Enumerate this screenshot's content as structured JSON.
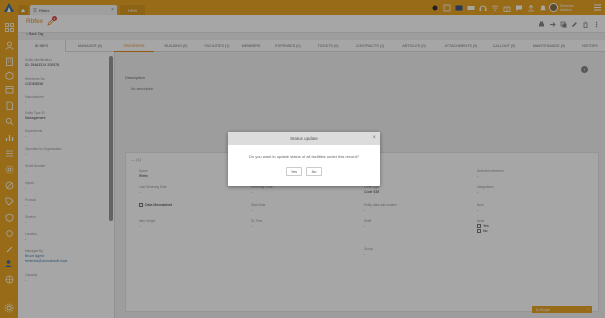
{
  "browser": {
    "active_tab": "Rbfex",
    "new_tab": "NEW",
    "close_glyph": "×"
  },
  "user": {
    "name": "Rkhender",
    "role": "Admin/s"
  },
  "page": {
    "title": "Rbfex",
    "badge": "3",
    "back_link": "< Back Tag"
  },
  "tabs": [
    {
      "label": "ID INFO"
    },
    {
      "label": "MANAGER (0)"
    },
    {
      "label": "PROGRESS"
    },
    {
      "label": "BUILDING (0)"
    },
    {
      "label": "FACILITIES (1)"
    },
    {
      "label": "MEMBERS"
    },
    {
      "label": "EXPENSES (0)"
    },
    {
      "label": "TICKETS (0)"
    },
    {
      "label": "CONTRACTS (1)"
    },
    {
      "label": "ARTICLES (0)"
    },
    {
      "label": "ATTACHMENTS (0)"
    },
    {
      "label": "CALLOUT (0)"
    },
    {
      "label": "MAINTENANCE (0)"
    },
    {
      "label": "HISTORY"
    }
  ],
  "info": {
    "fields": [
      {
        "label": "Entity Identification",
        "value": "ID: 2546331X 200578"
      },
      {
        "label": "Reference No",
        "value": "CODE8538"
      },
      {
        "label": "Manufacturer",
        "value": "-"
      },
      {
        "label": "Entity Type ID",
        "value": "Management"
      },
      {
        "label": "Dependents",
        "value": "-"
      },
      {
        "label": "Operated for Organisation",
        "value": "-"
      },
      {
        "label": "Serial Number",
        "value": "-"
      },
      {
        "label": "Import",
        "value": "-"
      },
      {
        "label": "Product",
        "value": "-"
      },
      {
        "label": "Service",
        "value": "-"
      },
      {
        "label": "Location",
        "value": "-"
      },
      {
        "label": "Managed By",
        "value": "Bruce Agent"
      },
      {
        "label": "",
        "value": "frederick@domainsoft.local"
      },
      {
        "label": "Capacity",
        "value": "-"
      }
    ]
  },
  "main": {
    "description_label": "Description",
    "description_value": "No description",
    "info_glyph": "i",
    "section_title": "— (1)",
    "fields": [
      {
        "label": "Name",
        "value": "Rbfex"
      },
      {
        "label": "Last Servicing Date",
        "value": "-"
      },
      {
        "label": "Servicing Code",
        "value": "-"
      },
      {
        "label": "Code Type",
        "value": "Code 538"
      },
      {
        "label": "Selected reference",
        "value": "-"
      },
      {
        "label": "Integrations",
        "value": "-"
      },
      {
        "label": "Start Date",
        "value": "-"
      },
      {
        "label": "Entity data add number",
        "value": "-"
      },
      {
        "label": "Next",
        "value": "-"
      },
      {
        "label": "Item Height",
        "value": "-"
      },
      {
        "label": "SL Time",
        "value": "-"
      },
      {
        "label": "Shelf",
        "value": "-"
      },
      {
        "label": "Units",
        "value": ""
      },
      {
        "label": "Group",
        "value": "-"
      }
    ],
    "data_mismatched": "Data Mismatched",
    "unit_options": [
      "Yes",
      "No"
    ]
  },
  "dialog": {
    "title": "Status update",
    "message": "Do you want to update status of all facilities under this record?",
    "yes": "Yes",
    "no": "No",
    "close": "×"
  },
  "bottom": {
    "label": "In Scope",
    "caret": "^"
  },
  "colors": {
    "brand": "#e8a524",
    "accent": "#e08a1e",
    "link": "#4a7fb5"
  }
}
